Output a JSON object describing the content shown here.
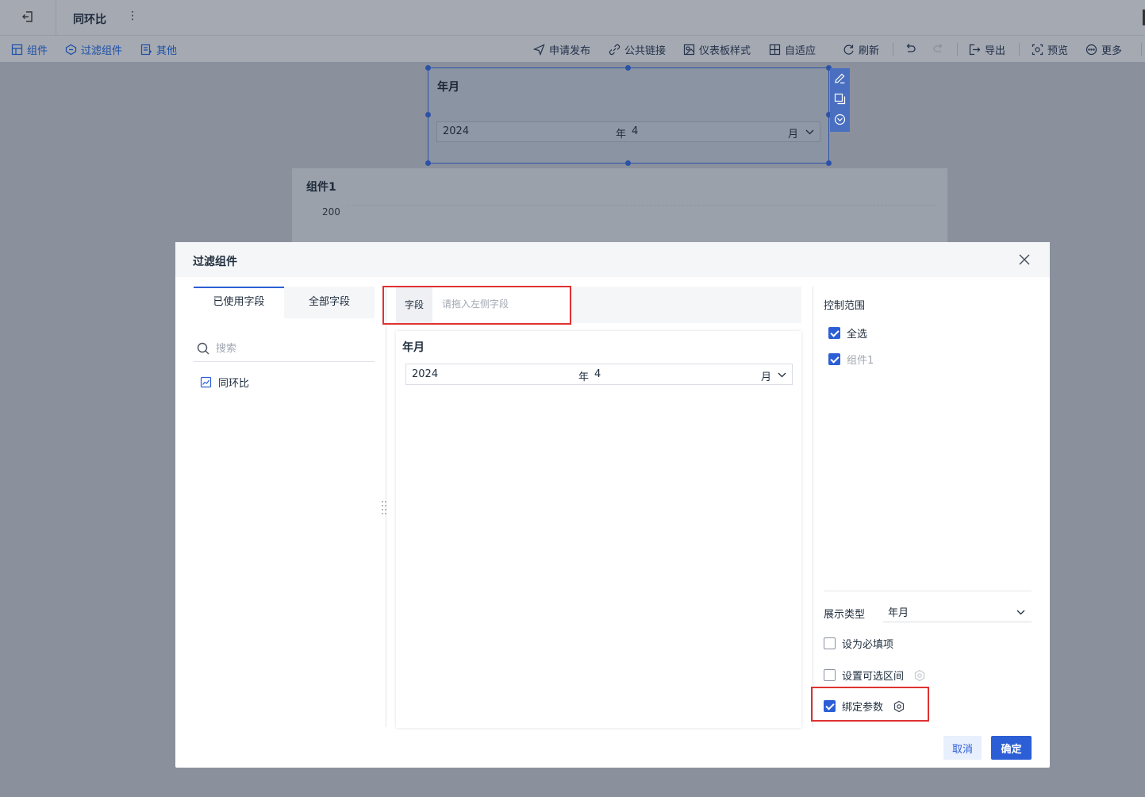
{
  "header": {
    "title": "同环比"
  },
  "toolbar": {
    "left": [
      {
        "label": "组件",
        "icon": "add-widget-icon"
      },
      {
        "label": "过滤组件",
        "icon": "filter-widget-icon"
      },
      {
        "label": "其他",
        "icon": "other-icon"
      }
    ],
    "right": [
      {
        "label": "申请发布",
        "icon": "send-icon"
      },
      {
        "label": "公共链接",
        "icon": "link-icon"
      },
      {
        "label": "仪表板样式",
        "icon": "style-icon"
      },
      {
        "label": "自适应",
        "icon": "grid-icon"
      },
      {
        "label": "刷新",
        "icon": "refresh-icon"
      },
      {
        "label": "导出",
        "icon": "export-icon"
      },
      {
        "label": "预览",
        "icon": "preview-icon"
      },
      {
        "label": "更多",
        "icon": "more-icon"
      }
    ]
  },
  "canvas": {
    "filter_widget": {
      "title": "年月",
      "year": "2024",
      "year_suffix": "年",
      "month": "4",
      "month_suffix": "月"
    },
    "chart_widget": {
      "title": "组件1",
      "tick": "200"
    }
  },
  "modal": {
    "title": "过滤组件",
    "tabs": [
      "已使用字段",
      "全部字段"
    ],
    "search_placeholder": "搜索",
    "fields": [
      "同环比"
    ],
    "field_label": "字段",
    "field_placeholder": "请拖入左侧字段",
    "preview": {
      "title": "年月",
      "year": "2024",
      "year_suffix": "年",
      "month": "4",
      "month_suffix": "月"
    },
    "control_scope": {
      "title": "控制范围",
      "select_all": "全选",
      "items": [
        "组件1"
      ]
    },
    "display_type": {
      "label": "展示类型",
      "value": "年月"
    },
    "options": {
      "required": "设为必填项",
      "range": "设置可选区间",
      "bind_param": "绑定参数"
    },
    "buttons": {
      "cancel": "取消",
      "ok": "确定"
    }
  },
  "colors": {
    "primary": "#2c5fd6",
    "highlight": "#e03131"
  }
}
